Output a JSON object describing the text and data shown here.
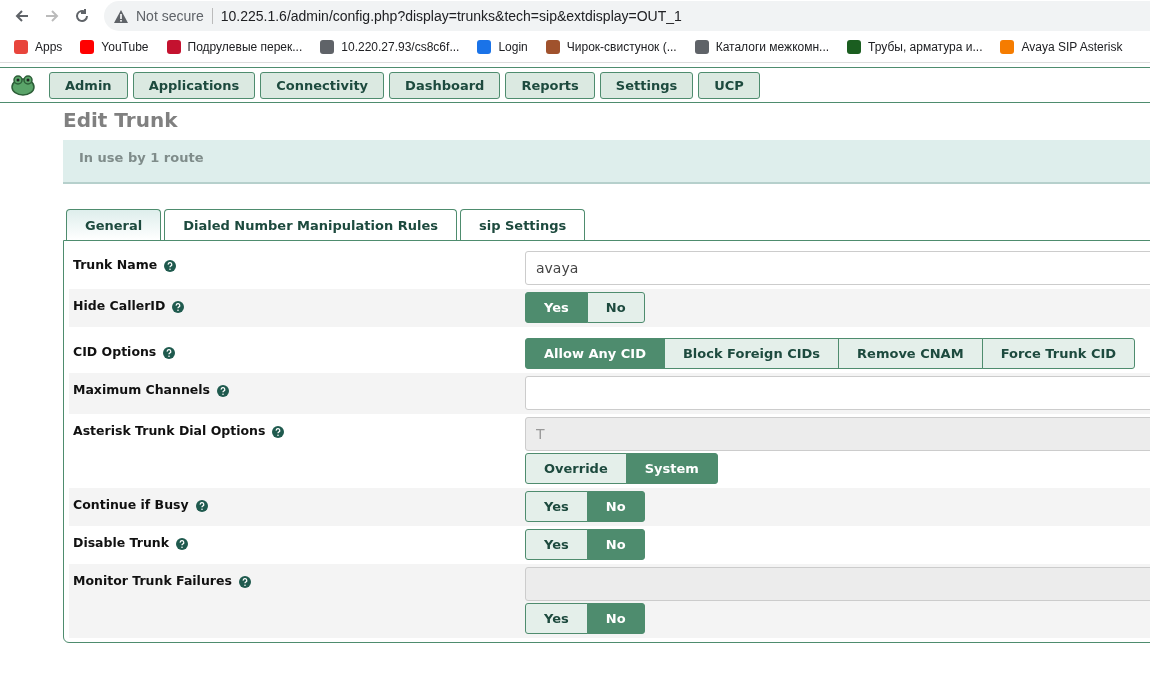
{
  "browser": {
    "security": "Not secure",
    "url": "10.225.1.6/admin/config.php?display=trunks&tech=sip&extdisplay=OUT_1"
  },
  "bookmarks": [
    "Apps",
    "YouTube",
    "Подрулевые перек...",
    "10.220.27.93/cs8c6f...",
    "Login",
    "Чирок-свистунок (...",
    "Каталоги межкомн...",
    "Трубы, арматура и...",
    "Avaya SIP Asterisk"
  ],
  "nav": [
    "Admin",
    "Applications",
    "Connectivity",
    "Dashboard",
    "Reports",
    "Settings",
    "UCP"
  ],
  "page_title": "Edit Trunk",
  "info": "In use by 1 route",
  "tabs": [
    {
      "label": "General",
      "selected": true
    },
    {
      "label": "Dialed Number Manipulation Rules",
      "selected": false
    },
    {
      "label": "sip Settings",
      "selected": false
    }
  ],
  "rows": [
    {
      "label": "Trunk Name",
      "controls": [
        {
          "kind": "input",
          "value": "avaya",
          "disabled": false
        }
      ]
    },
    {
      "label": "Hide CallerID",
      "controls": [
        {
          "kind": "segmented",
          "options": [
            {
              "label": "Yes",
              "selected": true
            },
            {
              "label": "No",
              "selected": false
            }
          ]
        }
      ]
    },
    {
      "label": "CID Options",
      "controls": [
        {
          "kind": "segmented",
          "options": [
            {
              "label": "Allow Any CID",
              "selected": true
            },
            {
              "label": "Block Foreign CIDs",
              "selected": false
            },
            {
              "label": "Remove CNAM",
              "selected": false
            },
            {
              "label": "Force Trunk CID",
              "selected": false
            }
          ]
        }
      ]
    },
    {
      "label": "Maximum Channels",
      "controls": [
        {
          "kind": "input",
          "disabled": false
        }
      ]
    },
    {
      "label": "Asterisk Trunk Dial Options",
      "controls": [
        {
          "kind": "input",
          "value": "T",
          "disabled": true
        },
        {
          "kind": "segmented",
          "options": [
            {
              "label": "Override",
              "selected": false
            },
            {
              "label": "System",
              "selected": true
            }
          ]
        }
      ]
    },
    {
      "label": "Continue if Busy",
      "controls": [
        {
          "kind": "segmented",
          "options": [
            {
              "label": "Yes",
              "selected": false
            },
            {
              "label": "No",
              "selected": true
            }
          ]
        }
      ]
    },
    {
      "label": "Disable Trunk",
      "controls": [
        {
          "kind": "segmented",
          "options": [
            {
              "label": "Yes",
              "selected": false
            },
            {
              "label": "No",
              "selected": true
            }
          ]
        }
      ]
    },
    {
      "label": "Monitor Trunk Failures",
      "controls": [
        {
          "kind": "input",
          "disabled": true
        },
        {
          "kind": "segmented",
          "options": [
            {
              "label": "Yes",
              "selected": false
            },
            {
              "label": "No",
              "selected": true
            }
          ]
        }
      ]
    }
  ]
}
